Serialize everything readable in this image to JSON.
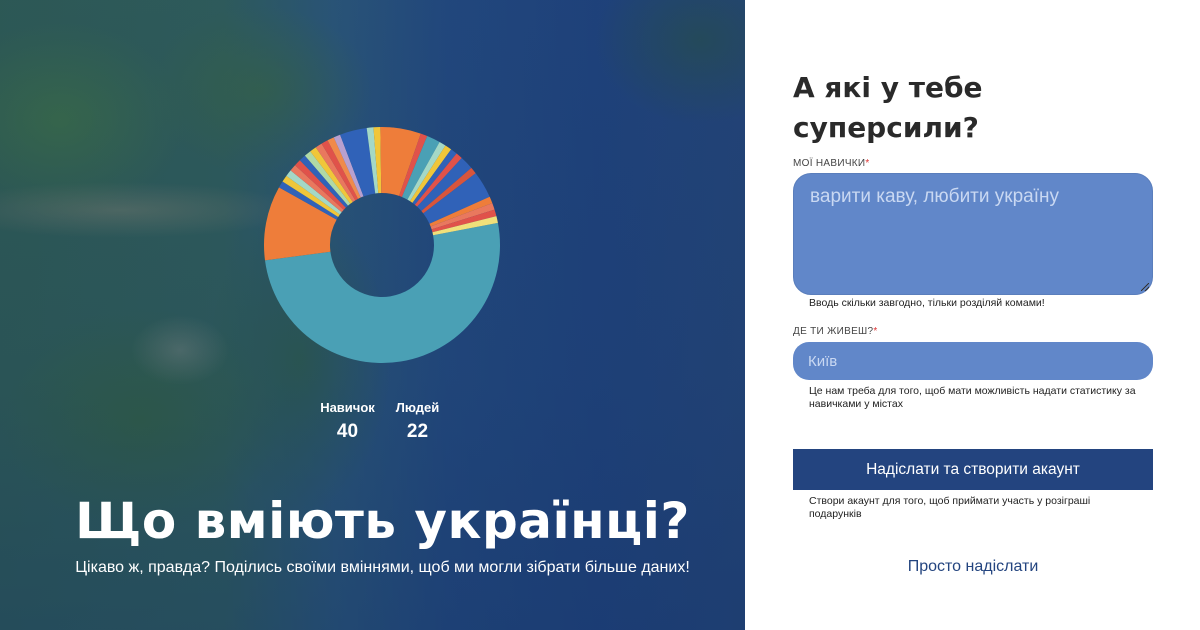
{
  "hero": {
    "stats": [
      {
        "label": "Навичок",
        "value": "40"
      },
      {
        "label": "Людей",
        "value": "22"
      }
    ],
    "title": "Що вміють українці?",
    "subtitle": "Цікаво ж, правда? Поділись своїми вміннями, щоб ми могли зібрати більше даних!"
  },
  "chart_data": {
    "type": "pie",
    "donut": true,
    "slice_values": [
      55,
      11,
      1,
      1,
      1,
      1,
      1,
      1,
      1,
      1,
      1,
      1,
      1,
      1,
      4,
      1,
      1,
      6,
      1,
      2,
      1,
      1,
      1,
      1,
      2,
      1,
      4,
      1,
      1,
      1,
      1
    ],
    "colors": [
      "#4aa0b5",
      "#ee7d3a",
      "#3062b8",
      "#f0c63a",
      "#a4d8c6",
      "#e9785e",
      "#e0524a",
      "#3062b8",
      "#b0d9a6",
      "#f0c63a",
      "#e9785e",
      "#e0524a",
      "#f08a4b",
      "#b8a0cf",
      "#3062b8",
      "#a4d8c6",
      "#f0c63a",
      "#ee7d3a",
      "#e0524a",
      "#4aa0b5",
      "#a4d8c6",
      "#f0c63a",
      "#3062b8",
      "#e0524a",
      "#3062b8",
      "#d8553c",
      "#3062b8",
      "#ee7d3a",
      "#e9785e",
      "#e0524a",
      "#f0e07a"
    ]
  },
  "form": {
    "title": "А які у тебе суперсили?",
    "skills": {
      "label": "МОЇ НАВИЧКИ",
      "required_mark": "*",
      "placeholder": "варити каву, любити україну",
      "hint": "Вводь скільки завгодно, тільки розділяй комами!"
    },
    "city": {
      "label": "ДЕ ТИ ЖИВЕШ?",
      "required_mark": "*",
      "placeholder": "Київ",
      "hint": "Це нам треба для того, щоб мати можливість надати статистику за навичками у містах"
    },
    "submit_label": "Надіслати та створити акаунт",
    "submit_hint": "Створи акаунт для того, щоб приймати участь у розіграші подарунків",
    "simple_submit_label": "Просто надіслати"
  }
}
